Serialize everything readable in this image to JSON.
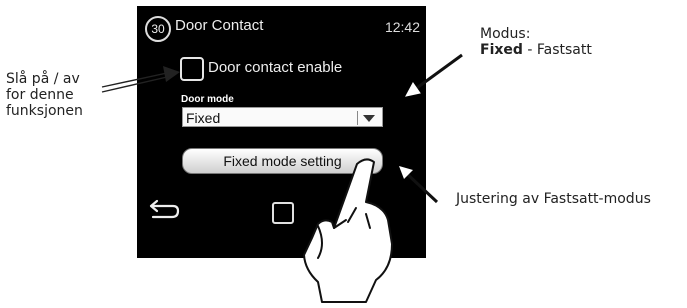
{
  "annotations": {
    "left": [
      "Slå på / av",
      "for denne",
      "funksjonen"
    ],
    "top_right": {
      "line1": "Modus:",
      "line2_bold": "Fixed",
      "line2_rest": " - Fastsatt"
    },
    "bottom_right": "Justering av Fastsatt-modus"
  },
  "device": {
    "status": {
      "badge": "30",
      "title": "Door Contact",
      "time": "12:42"
    },
    "door_contact_enable_label": "Door contact enable",
    "door_mode_label": "Door mode",
    "door_mode_value": "Fixed",
    "fixed_mode_button_label": "Fixed mode setting"
  },
  "icons": {
    "back": "back-arrow-icon",
    "home": "home-square-icon",
    "hand": "pointing-hand-icon"
  }
}
